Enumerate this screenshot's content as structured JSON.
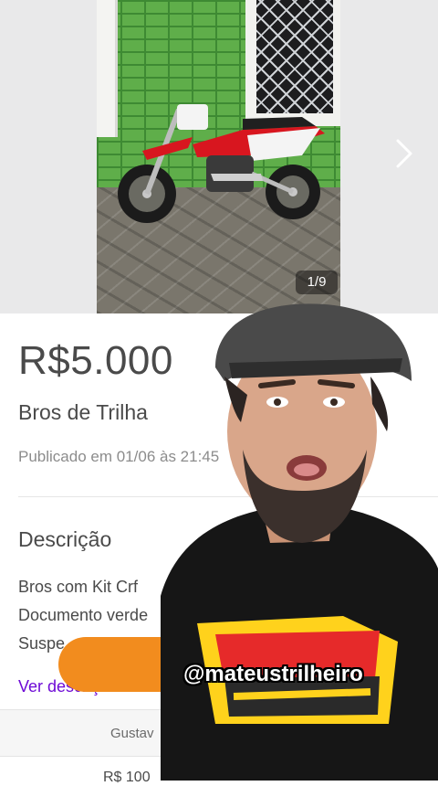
{
  "listing": {
    "image_counter": "1/9",
    "price": "R$5.000",
    "title": "Bros de Trilha",
    "published": "Publicado em 01/06 às 21:45",
    "description_heading": "Descrição",
    "description_lines": [
      "Bros com Kit Crf",
      "Documento verde",
      "Suspe"
    ],
    "see_more": "Ver descrição co",
    "table_header": "Gustav",
    "table_value": "R$ 100"
  },
  "overlay": {
    "handle": "@mateustrilheiro"
  },
  "icons": {
    "next": "chevron-right-icon"
  },
  "colors": {
    "link": "#6e0ad6",
    "button": "#f28c1e",
    "text": "#4a4a4a",
    "muted": "#8c8c8c"
  }
}
